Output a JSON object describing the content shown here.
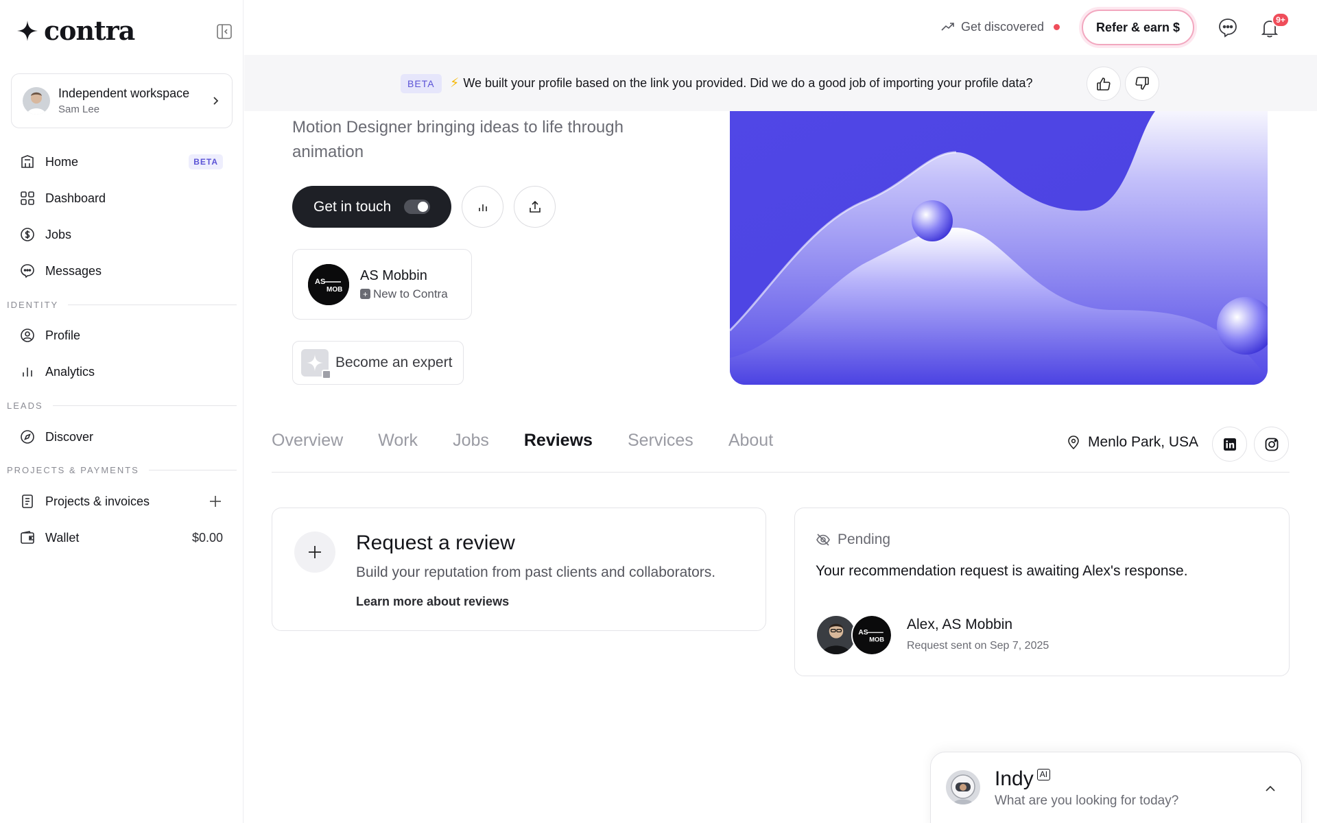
{
  "brand": {
    "name": "contra"
  },
  "workspace": {
    "title": "Independent workspace",
    "user": "Sam Lee"
  },
  "nav": {
    "home": {
      "label": "Home",
      "badge": "BETA"
    },
    "dashboard": {
      "label": "Dashboard"
    },
    "jobs": {
      "label": "Jobs"
    },
    "messages": {
      "label": "Messages"
    },
    "identity_label": "IDENTITY",
    "profile": {
      "label": "Profile"
    },
    "analytics": {
      "label": "Analytics"
    },
    "leads_label": "LEADS",
    "discover": {
      "label": "Discover"
    },
    "projects_label": "PROJECTS & PAYMENTS",
    "projects": {
      "label": "Projects & invoices"
    },
    "wallet": {
      "label": "Wallet",
      "balance": "$0.00"
    }
  },
  "topbar": {
    "discover_label": "Get discovered",
    "refer_label": "Refer & earn $",
    "notification_count": "9+"
  },
  "banner": {
    "tag": "BETA",
    "text": "We built your profile based on the link you provided. Did we do a good job of importing your profile data?"
  },
  "profile": {
    "tagline": "Motion Designer bringing ideas to life through animation",
    "cta_label": "Get in touch",
    "org": {
      "name": "AS Mobbin",
      "status": "New to Contra",
      "logo_text_top": "AS",
      "logo_text_bottom": "MOB"
    },
    "expert_label": "Become an expert",
    "location": "Menlo Park, USA"
  },
  "tabs": [
    "Overview",
    "Work",
    "Jobs",
    "Reviews",
    "Services",
    "About"
  ],
  "active_tab": "Reviews",
  "request_review": {
    "title": "Request a review",
    "description": "Build your reputation from past clients and collaborators.",
    "link": "Learn more about reviews"
  },
  "pending": {
    "status": "Pending",
    "message": "Your recommendation request is awaiting Alex's response.",
    "names": "Alex, AS Mobbin",
    "date": "Request sent on Sep 7, 2025"
  },
  "indy": {
    "name": "Indy",
    "badge": "AI",
    "prompt": "What are you looking for today?"
  },
  "colors": {
    "accent": "#5b53d6",
    "hero_blue": "#4f46e5",
    "dark_button": "#1e2026",
    "alert_red": "#ef4d5a"
  }
}
